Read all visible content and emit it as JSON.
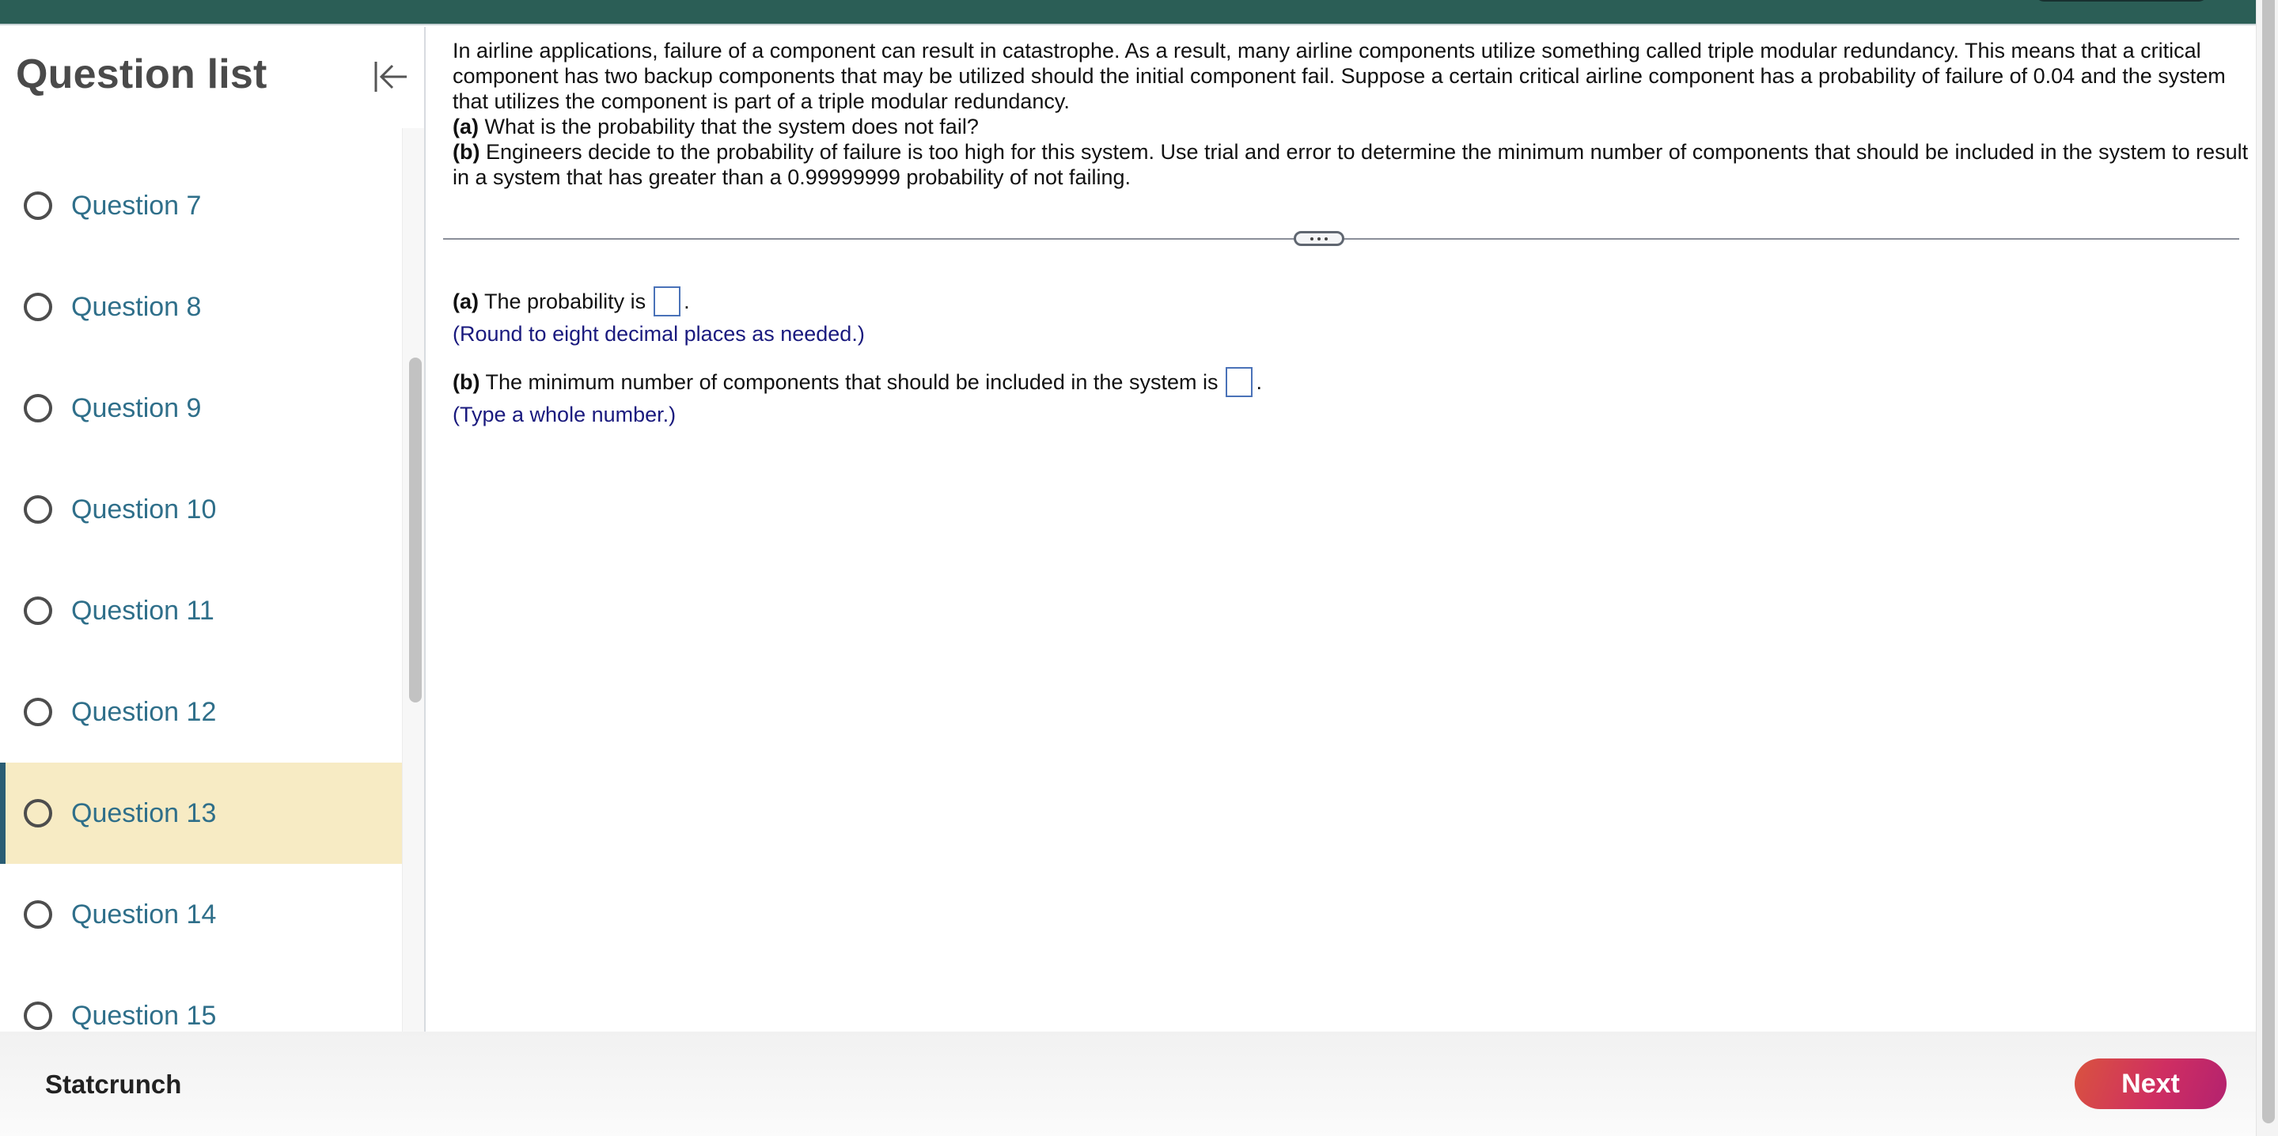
{
  "topbar": {
    "cut_text": "",
    "color": "#2b5e56"
  },
  "sidebar": {
    "title": "Question list",
    "collapse_icon": "collapse-left-icon",
    "items": [
      {
        "label": "Question 7",
        "active": false
      },
      {
        "label": "Question 8",
        "active": false
      },
      {
        "label": "Question 9",
        "active": false
      },
      {
        "label": "Question 10",
        "active": false
      },
      {
        "label": "Question 11",
        "active": false
      },
      {
        "label": "Question 12",
        "active": false
      },
      {
        "label": "Question 13",
        "active": true
      },
      {
        "label": "Question 14",
        "active": false
      },
      {
        "label": "Question 15",
        "active": false
      }
    ],
    "active_bg": "#f7ebc4",
    "active_accent": "#2a5d74",
    "item_color": "#2f6f8a"
  },
  "question": {
    "intro": "In airline applications, failure of a component can result in catastrophe. As a result, many airline components utilize something called triple modular redundancy. This means that a critical component has two backup components that may be utilized should the initial component fail. Suppose a certain critical airline component has a probability of failure of 0.04 and the system that utilizes the component is part of a triple modular redundancy.",
    "part_a_label": "(a)",
    "part_a_text": "What is the probability that the system does not fail?",
    "part_b_label": "(b)",
    "part_b_text": "Engineers decide to the probability of failure is too high for this system. Use trial and error to determine the minimum number of components that should be included in the system to result in a system that has greater than a 0.99999999 probability of not failing."
  },
  "divider": {
    "handle_icon": "more-horizontal-icon"
  },
  "answers": {
    "a": {
      "label": "(a)",
      "text": "The probability is",
      "value": "",
      "suffix": ".",
      "hint": "(Round to eight decimal places as needed.)"
    },
    "b": {
      "label": "(b)",
      "text": "The minimum number of components that should be included in the system is",
      "value": "",
      "suffix": ".",
      "hint": "(Type a whole number.)"
    }
  },
  "footer": {
    "brand": "Statcrunch",
    "next_label": "Next",
    "next_gradient": [
      "#d9533f",
      "#cf2e62",
      "#b3226f"
    ]
  }
}
